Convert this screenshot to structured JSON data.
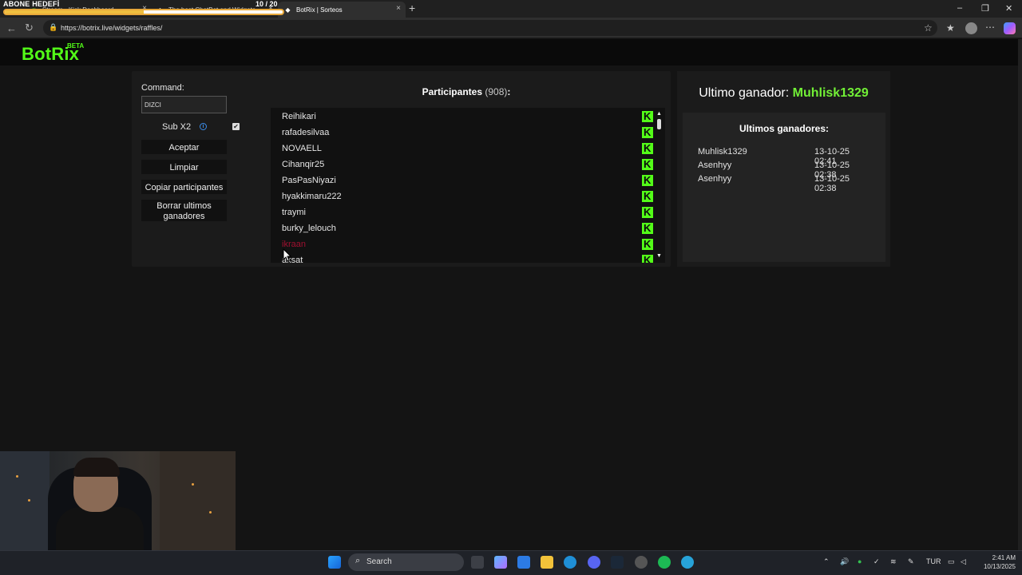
{
  "overlay": {
    "goal_title": "ABONE HEDEFİ",
    "goal_count": "10 / 20",
    "goal_progress": 0.5
  },
  "browser": {
    "tabs": [
      {
        "label": "Stream - Kick Dashboard"
      },
      {
        "label": "The best ChatBot and Widgets"
      },
      {
        "label": "BotRix | Sorteos"
      }
    ],
    "url": "https://botrix.live/widgets/raffles/"
  },
  "site": {
    "logo": "BotRix",
    "logo_badge": "BETA"
  },
  "controls": {
    "command_label": "Command:",
    "command_value": "DIZCI",
    "sub_label": "Sub X2",
    "sub_checked": true,
    "buttons": {
      "accept": "Aceptar",
      "clear": "Limpiar",
      "copy": "Copiar participantes",
      "delete_winners": "Borrar ultimos ganadores"
    }
  },
  "participants": {
    "title": "Participantes",
    "count": "(908)",
    "suffix": ":",
    "list": [
      "Reihikari",
      "rafadesilvaa",
      "NOVAELL",
      "Cihanqir25",
      "PasPasNiyazi",
      "hyakkimaru222",
      "traymi",
      "burky_lelouch",
      "ikraan",
      "aksat"
    ]
  },
  "winner": {
    "label": "Ultimo ganador:",
    "name": "Muhlisk1329",
    "history_title": "Ultimos ganadores:",
    "history": [
      {
        "name": "Muhlisk1329",
        "date": "13-10-25 02:41"
      },
      {
        "name": "Asenhyy",
        "date": "13-10-25 02:38"
      },
      {
        "name": "Asenhyy",
        "date": "13-10-25 02:38"
      }
    ]
  },
  "taskbar": {
    "search_label": "Search",
    "language": "TUR",
    "time": "2:41 AM",
    "date": "10/13/2025"
  },
  "colors": {
    "accent": "#53fc18",
    "winner": "#72f036",
    "highlight_name": "#a01030"
  }
}
